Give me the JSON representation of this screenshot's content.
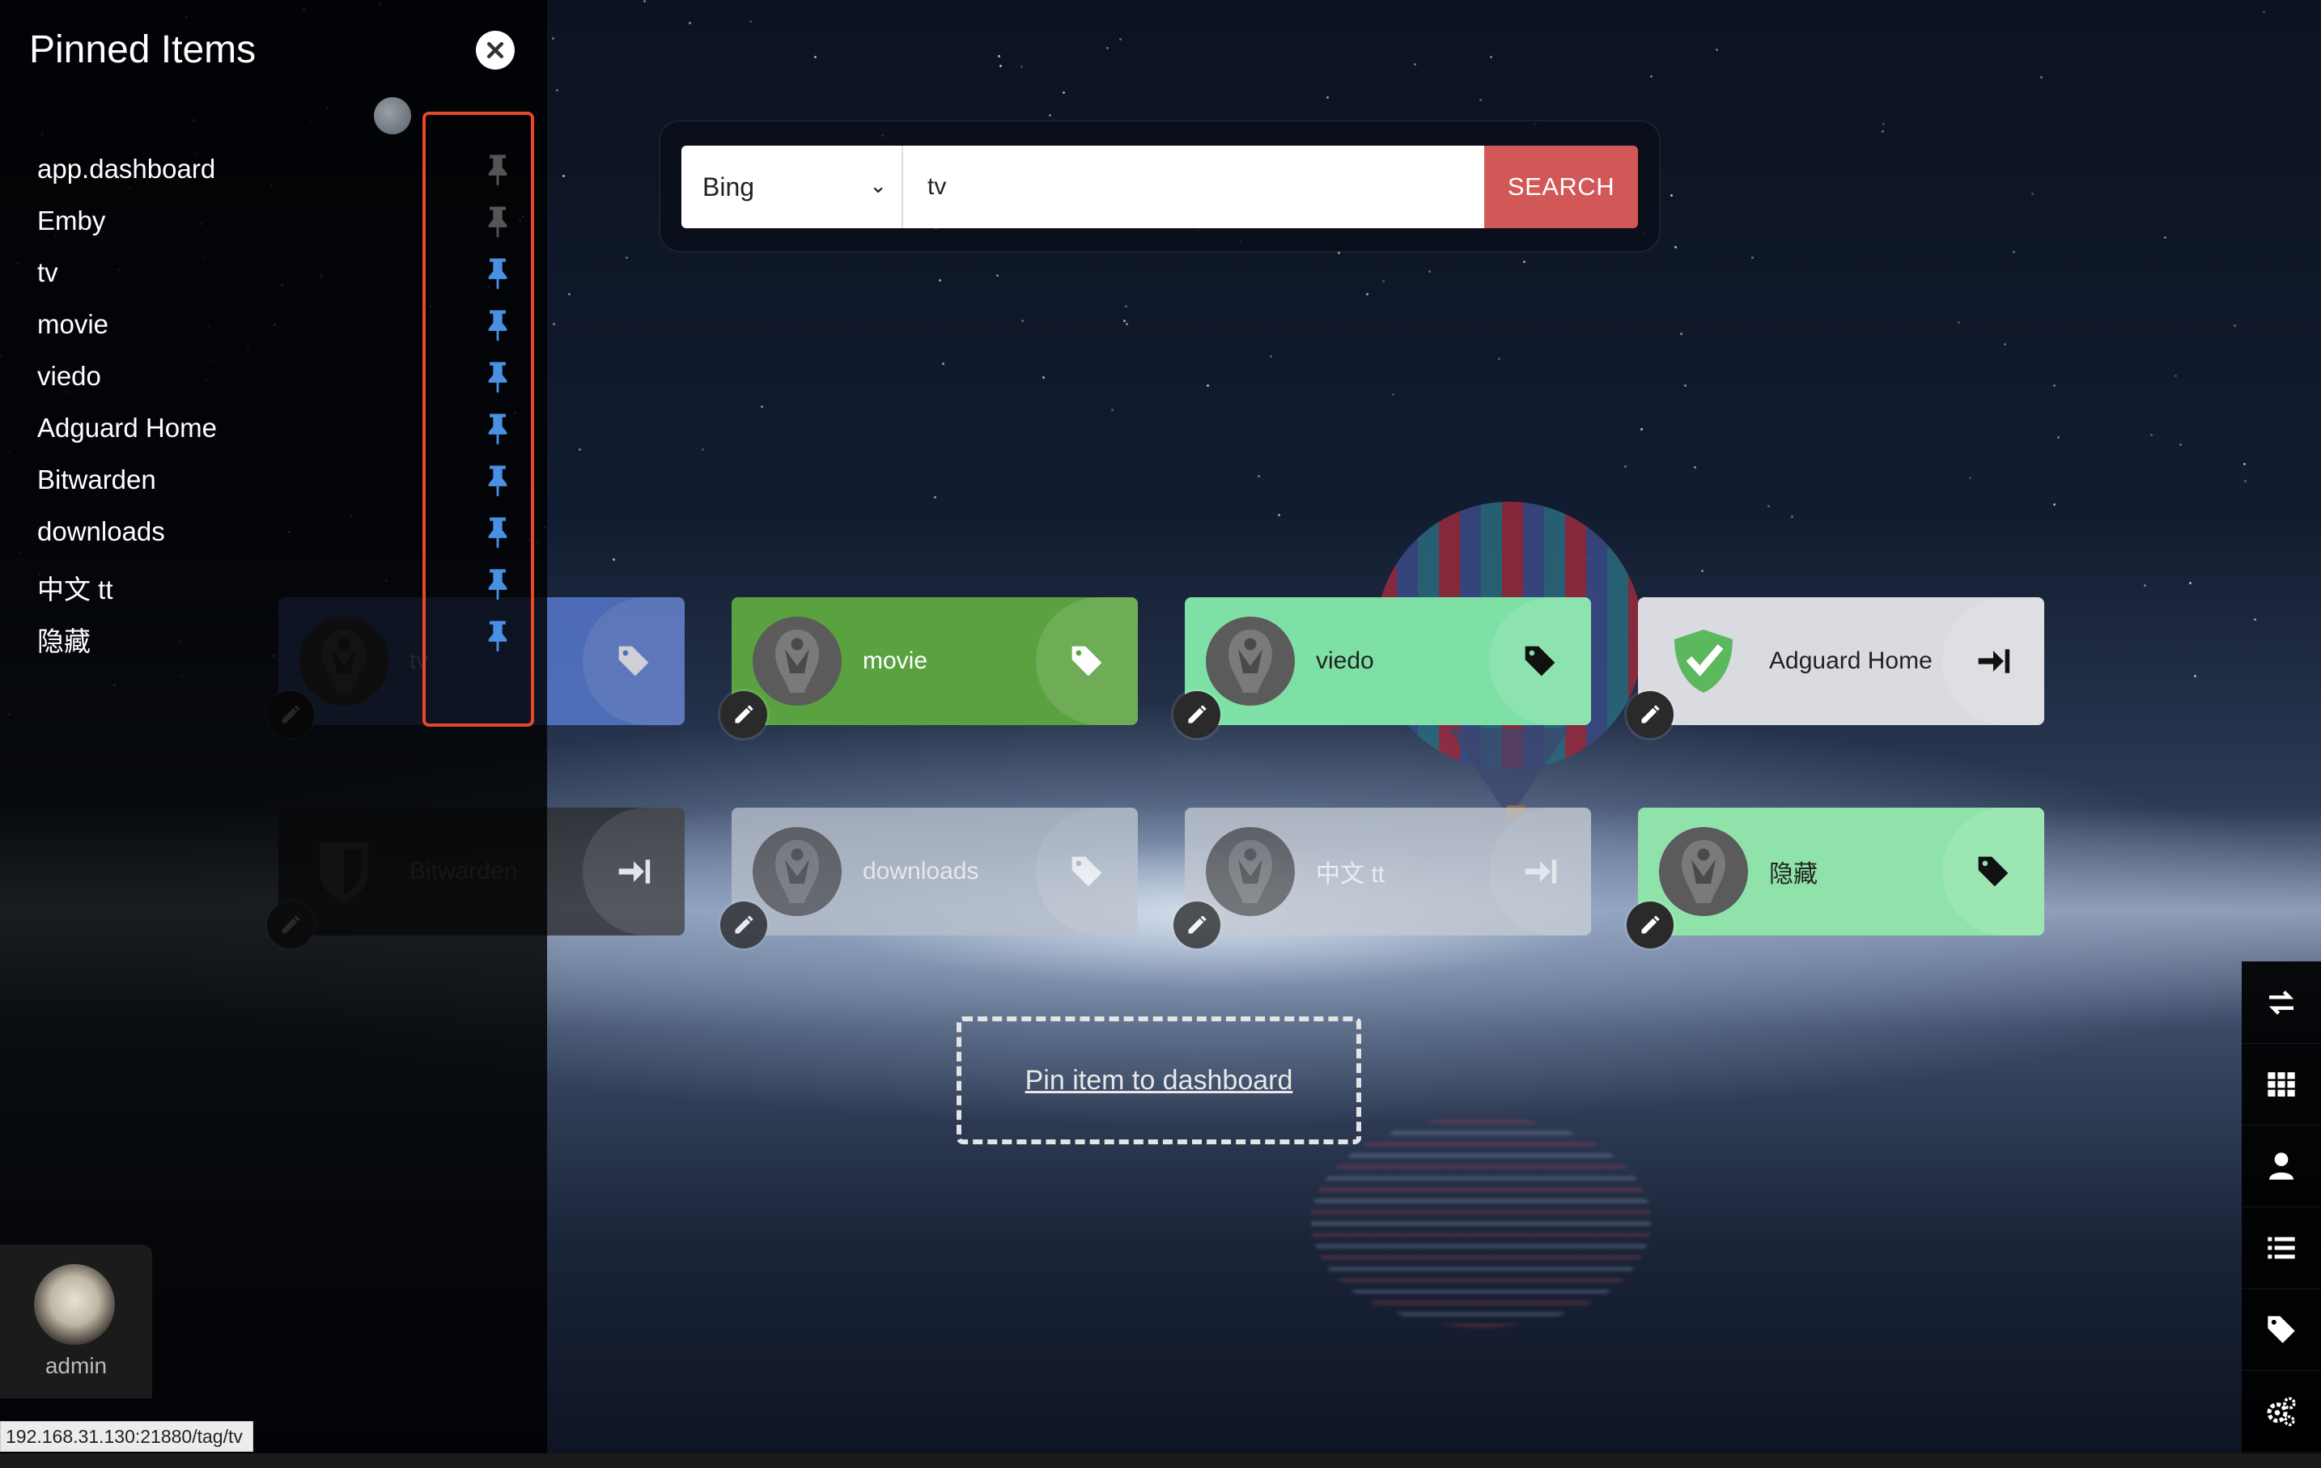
{
  "sidebar": {
    "title": "Pinned Items",
    "close_icon": "close-circle-icon",
    "items": [
      {
        "label": "app.dashboard",
        "pinned": false
      },
      {
        "label": "Emby",
        "pinned": false
      },
      {
        "label": "tv",
        "pinned": true
      },
      {
        "label": "movie",
        "pinned": true
      },
      {
        "label": "viedo",
        "pinned": true
      },
      {
        "label": "Adguard Home",
        "pinned": true
      },
      {
        "label": "Bitwarden",
        "pinned": true
      },
      {
        "label": "downloads",
        "pinned": true
      },
      {
        "label": "中文 tt",
        "pinned": true
      },
      {
        "label": "隐藏",
        "pinned": true
      }
    ],
    "pin_color_active": "#4a90e2",
    "pin_color_inactive": "#555555"
  },
  "search": {
    "provider": "Bing",
    "query": "tv",
    "button_label": "SEARCH",
    "button_color": "#d25757"
  },
  "tiles": [
    {
      "name": "tv",
      "color": "#5b7fd9",
      "icon": "heimdall-logo-icon",
      "action_icon": "tag-icon",
      "faded": true
    },
    {
      "name": "movie",
      "color": "#5aa23f",
      "icon": "heimdall-logo-icon",
      "action_icon": "tag-icon",
      "faded": false
    },
    {
      "name": "viedo",
      "color": "#7ee0a4",
      "icon": "heimdall-logo-icon",
      "action_icon": "tag-icon",
      "faded": false
    },
    {
      "name": "Adguard Home",
      "color": "#d9dbe0",
      "icon": "adguard-shield-icon",
      "action_icon": "arrow-to-right-icon",
      "faded": false
    },
    {
      "name": "Bitwarden",
      "color": "#2b2b2b",
      "icon": "bitwarden-shield-icon",
      "action_icon": "arrow-to-right-icon",
      "faded": true
    },
    {
      "name": "downloads",
      "color": "#b6bec9",
      "icon": "heimdall-logo-icon",
      "action_icon": "tag-icon",
      "faded": true
    },
    {
      "name": "中文 tt",
      "color": "#c3c9d2",
      "icon": "heimdall-logo-icon",
      "action_icon": "arrow-to-right-icon",
      "faded": true
    },
    {
      "name": "隐藏",
      "color": "#8fe3aa",
      "icon": "heimdall-logo-icon",
      "action_icon": "tag-icon",
      "faded": false
    }
  ],
  "pin_zone": {
    "label": "Pin item to dashboard"
  },
  "user": {
    "name": "admin"
  },
  "status_bar": {
    "url": "192.168.31.130:21880/tag/tv"
  },
  "rail": [
    "swap-icon",
    "grid-icon",
    "user-icon",
    "list-icon",
    "tag-icon",
    "cogs-icon"
  ]
}
